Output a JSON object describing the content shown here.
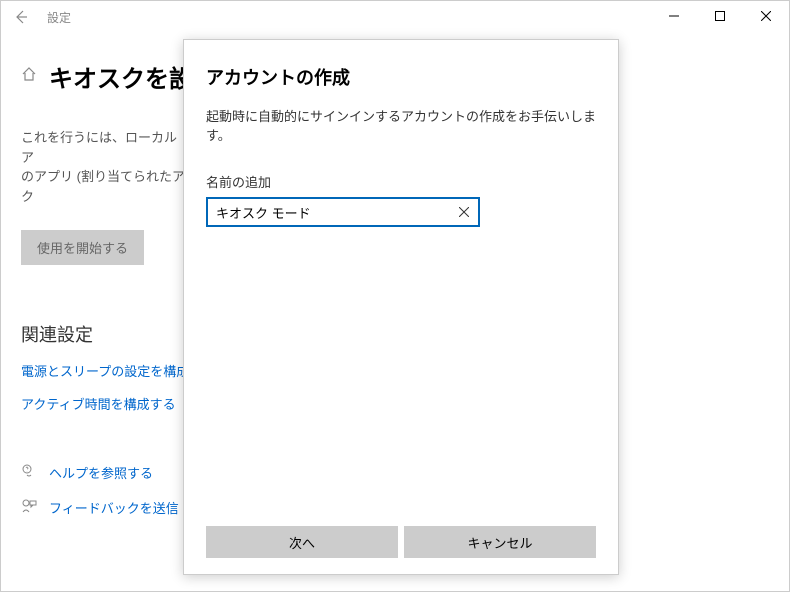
{
  "titlebar": {
    "app_title": "設定"
  },
  "page": {
    "title": "キオスクを設",
    "description_line1": "これを行うには、ローカル ア",
    "description_line2": "のアプリ (割り当てられたアク",
    "start_button": "使用を開始する",
    "related_heading": "関連設定",
    "link_power": "電源とスリープの設定を構成",
    "link_active": "アクティブ時間を構成する",
    "help_label": "ヘルプを参照する",
    "feedback_label": "フィードバックを送信"
  },
  "modal": {
    "title": "アカウントの作成",
    "description": "起動時に自動的にサインインするアカウントの作成をお手伝いします。",
    "field_label": "名前の追加",
    "input_value": "キオスク モード",
    "next_button": "次へ",
    "cancel_button": "キャンセル"
  }
}
